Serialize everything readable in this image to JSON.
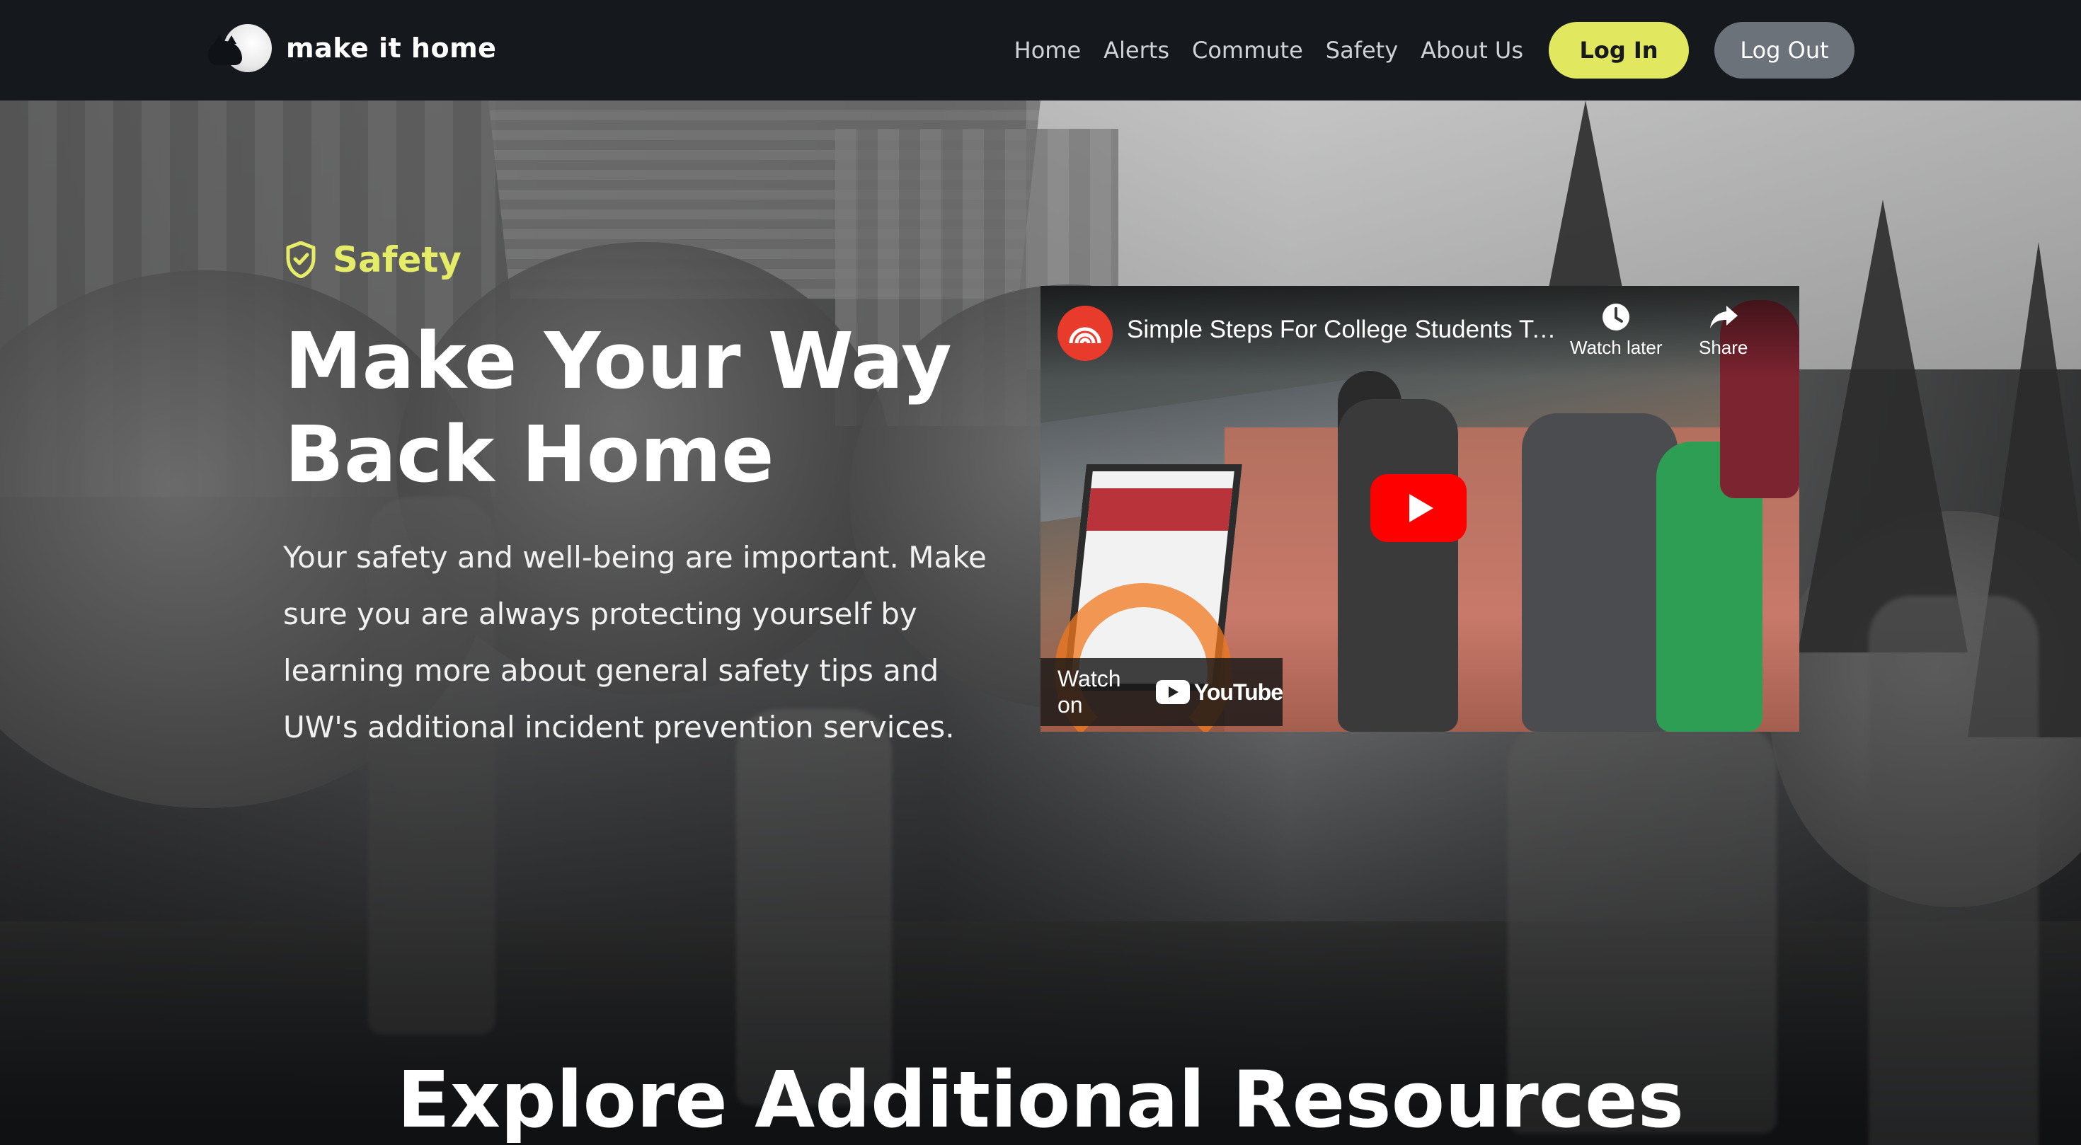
{
  "brand": {
    "name": "make it home",
    "logo_icon": "moon-cat-logo-icon"
  },
  "nav": {
    "links": [
      "Home",
      "Alerts",
      "Commute",
      "Safety",
      "About Us"
    ],
    "login_label": "Log In",
    "logout_label": "Log Out"
  },
  "hero": {
    "section_tag": "Safety",
    "section_icon": "shield-icon",
    "title_line1": "Make Your Way",
    "title_line2": "Back Home",
    "description": "Your safety and well-being are important. Make sure you are always protecting yourself by learning more about general safety tips and UW's additional incident prevention services."
  },
  "video": {
    "title": "Simple Steps For College Students To Stay Safe On Campus",
    "watch_later_label": "Watch later",
    "share_label": "Share",
    "watch_on_label": "Watch on",
    "youtube_label": "YouTube"
  },
  "explore": {
    "heading": "Explore Additional Resources"
  },
  "colors": {
    "nav_background": "#15191e",
    "accent": "#e1e85f",
    "logout_button": "#6c727a",
    "youtube_red": "#ff0000"
  }
}
